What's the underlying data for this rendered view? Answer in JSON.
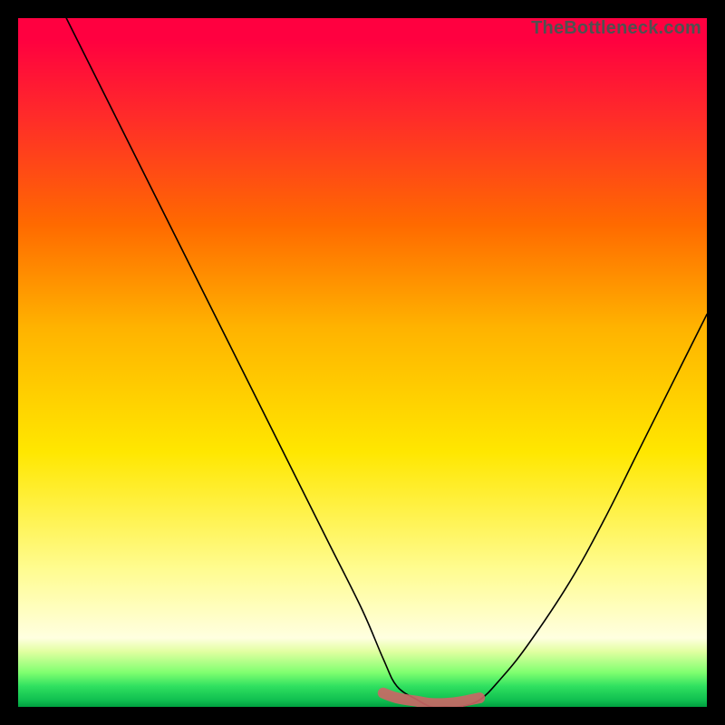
{
  "watermark": "TheBottleneck.com",
  "chart_data": {
    "type": "line",
    "title": "",
    "xlabel": "",
    "ylabel": "",
    "xlim": [
      0,
      100
    ],
    "ylim": [
      0,
      100
    ],
    "series": [
      {
        "name": "bottleneck-curve",
        "x": [
          7,
          10,
          15,
          20,
          25,
          30,
          35,
          40,
          45,
          50,
          53,
          55,
          58,
          60,
          62,
          64,
          67,
          70,
          74,
          80,
          85,
          90,
          95,
          100
        ],
        "values": [
          100,
          94,
          84,
          74,
          64,
          54,
          44,
          34,
          24,
          14,
          7,
          3,
          1,
          0,
          0,
          0,
          1,
          4,
          9,
          18,
          27,
          37,
          47,
          57
        ]
      },
      {
        "name": "highlight-band",
        "x": [
          53,
          55,
          58,
          60,
          62,
          64,
          67
        ],
        "values": [
          2,
          1.3,
          0.8,
          0.5,
          0.5,
          0.7,
          1.3
        ]
      }
    ]
  }
}
